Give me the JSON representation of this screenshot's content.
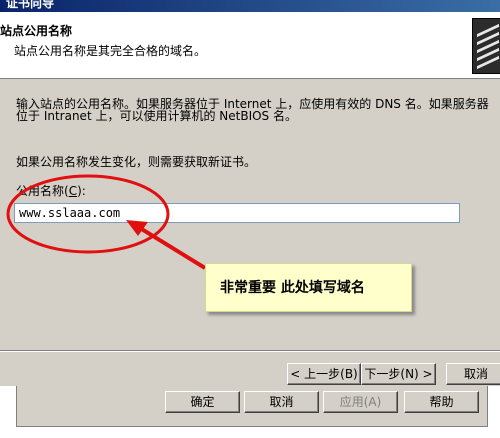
{
  "window": {
    "title": "证书向导"
  },
  "header": {
    "title": "站点公用名称",
    "subtitle": "站点公用名称是其完全合格的域名。",
    "icon": "wizard-icon"
  },
  "body": {
    "paragraph_line1": "输入站点的公用名称。如果服务器位于 Internet 上，应使用有效的 DNS 名。如果服务器",
    "paragraph_line2": "位于 Intranet 上，可以使用计算机的 NetBIOS 名。",
    "note": "如果公用名称发生变化，则需要获取新证书。"
  },
  "form": {
    "common_name_label_prefix": "公用名称(",
    "common_name_label_accel": "C",
    "common_name_label_suffix": "):",
    "common_name_value": "www.sslaaa.com"
  },
  "buttons": {
    "back": "< 上一步(B)",
    "next": "下一步(N) >",
    "cancel": "取消"
  },
  "outer_buttons": {
    "ok": "确定",
    "cancel": "取消",
    "apply": "应用(A)",
    "help": "帮助"
  },
  "annotation": {
    "callout_text": "非常重要 此处填写域名",
    "colors": {
      "ellipse": "#e01010",
      "arrow": "#e01010",
      "callout_bg": "#ffffcc"
    }
  }
}
